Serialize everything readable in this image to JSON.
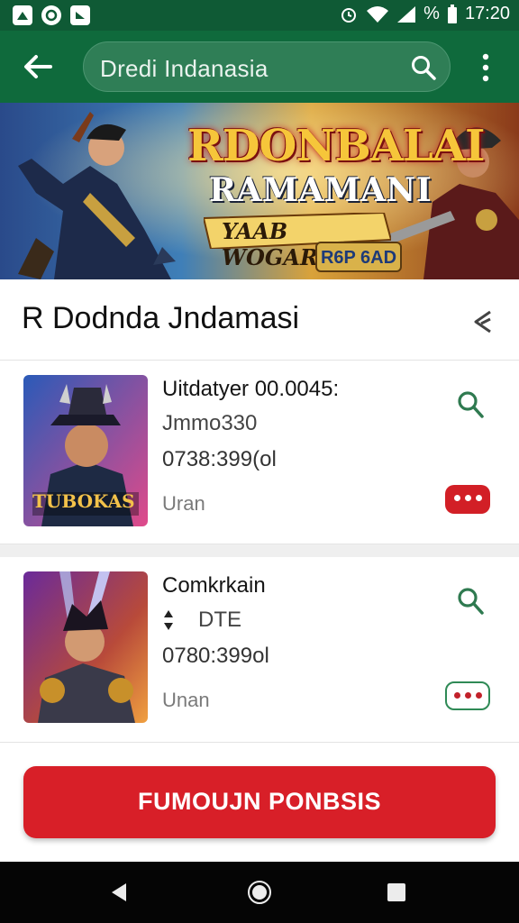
{
  "status_bar": {
    "time": "17:20",
    "battery_text": "%",
    "icons": [
      "notification-icon",
      "record-icon",
      "media-icon",
      "alarm-icon",
      "wifi-icon",
      "signal-icon",
      "battery-icon"
    ]
  },
  "app_bar": {
    "search_text": "Dredi Indanasia",
    "icons": [
      "back-arrow-icon",
      "search-icon",
      "more-vert-icon"
    ]
  },
  "banner": {
    "title_line1": "RDONBALAI",
    "title_line2": "RAMAMANI",
    "title_line3": "YAAB WOGARIOIS",
    "badge": "R6P 6AD"
  },
  "section": {
    "title": "R Dodnda Jndamasi",
    "icon": "share-icon"
  },
  "items": [
    {
      "title": "Uitdatyer 00.0045:",
      "line2": "Jmmo330",
      "line3": "0738:399(ol",
      "meta": "Uran",
      "thumb_caption": "TUBOKAS",
      "more_style": "filled"
    },
    {
      "title": "Comkrkain",
      "line2": "DTE",
      "line3": "0780:399ol",
      "meta": "Unan",
      "more_style": "outline"
    }
  ],
  "cta": {
    "label": "FUMOUJN PONBSIS"
  },
  "colors": {
    "status_bar": "#0f5a35",
    "app_bar": "#0f6a3c",
    "accent_green": "#2f8a56",
    "accent_red": "#d81f28"
  },
  "nav_bar": {
    "icons": [
      "nav-back-icon",
      "nav-home-icon",
      "nav-recents-icon"
    ]
  }
}
